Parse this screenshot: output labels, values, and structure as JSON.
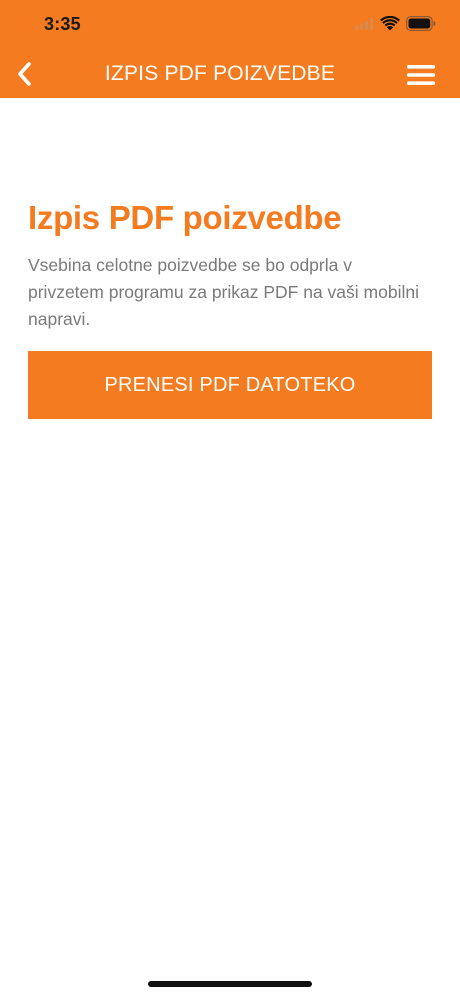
{
  "status_bar": {
    "time": "3:35",
    "icons": [
      "signal-icon",
      "wifi-icon",
      "battery-icon"
    ]
  },
  "nav": {
    "title": "IZPIS PDF POIZVEDBE",
    "back_icon": "chevron-left-icon",
    "menu_icon": "hamburger-menu-icon"
  },
  "main": {
    "heading": "Izpis PDF poizvedbe",
    "description": "Vsebina celotne poizvedbe se bo odprla v privzetem programu za prikaz PDF na vaši mobilni napravi.",
    "download_button_label": "PRENESI PDF DATOTEKO"
  },
  "colors": {
    "accent": "#F47B20",
    "background": "#FFFFFF",
    "body_text": "#7A7A7A"
  }
}
